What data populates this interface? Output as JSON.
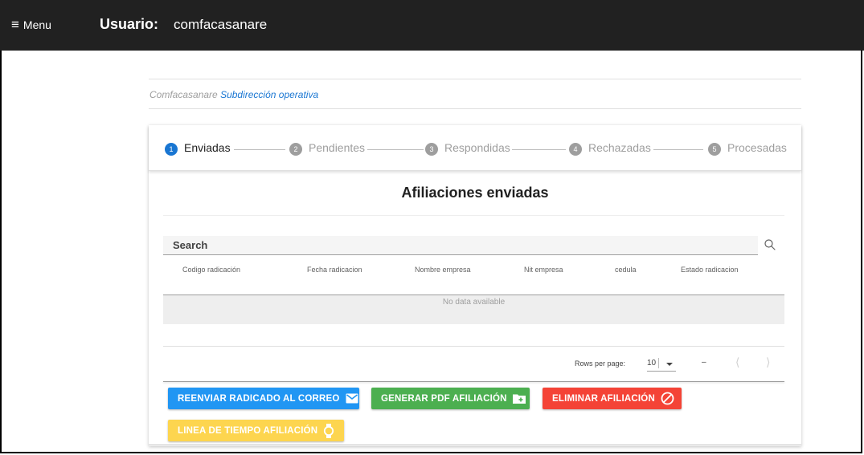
{
  "header": {
    "menu_icon": "menu-icon",
    "menu_label": "Menu",
    "user_label": "Usuario:",
    "user_name": "comfacasanare",
    "background": "#212121"
  },
  "breadcrumb": {
    "root": "Comfacasanare",
    "current": "Subdirección operativa"
  },
  "stepper": {
    "steps": [
      {
        "number": "1",
        "label": "Enviadas",
        "active": true
      },
      {
        "number": "2",
        "label": "Pendientes",
        "active": false
      },
      {
        "number": "3",
        "label": "Respondidas",
        "active": false
      },
      {
        "number": "4",
        "label": "Rechazadas",
        "active": false
      },
      {
        "number": "5",
        "label": "Procesadas",
        "active": false
      }
    ],
    "active_color": "#1976d2"
  },
  "section": {
    "title": "Afiliaciones enviadas"
  },
  "table": {
    "search_label": "Search",
    "search_icon": "search-icon",
    "columns": [
      "Codigo radicación",
      "Fecha radicacion",
      "Nombre empresa",
      "Nit empresa",
      "cedula",
      "Estado radicacion"
    ],
    "empty_text": "No data available",
    "footer": {
      "rows_per_page_label": "Rows per page:",
      "rows_per_page_value": "10",
      "page_range": "–",
      "prev_icon": "chevron-left-icon",
      "next_icon": "chevron-right-icon"
    }
  },
  "actions": {
    "resend": {
      "label": "REENVIAR RADICADO AL CORREO",
      "icon": "mail-icon",
      "color": "#2196f3"
    },
    "pdf": {
      "label": "GENERAR PDF AFILIACIÓN",
      "icon": "folder-plus-icon",
      "color": "#4caf50"
    },
    "delete": {
      "label": "ELIMINAR AFILIACIÓN",
      "icon": "block-icon",
      "color": "#f44336"
    },
    "timeline": {
      "label": "LINEA DE TIEMPO AFILIACIÓN",
      "icon": "watch-icon",
      "color": "#fdd54f"
    }
  }
}
